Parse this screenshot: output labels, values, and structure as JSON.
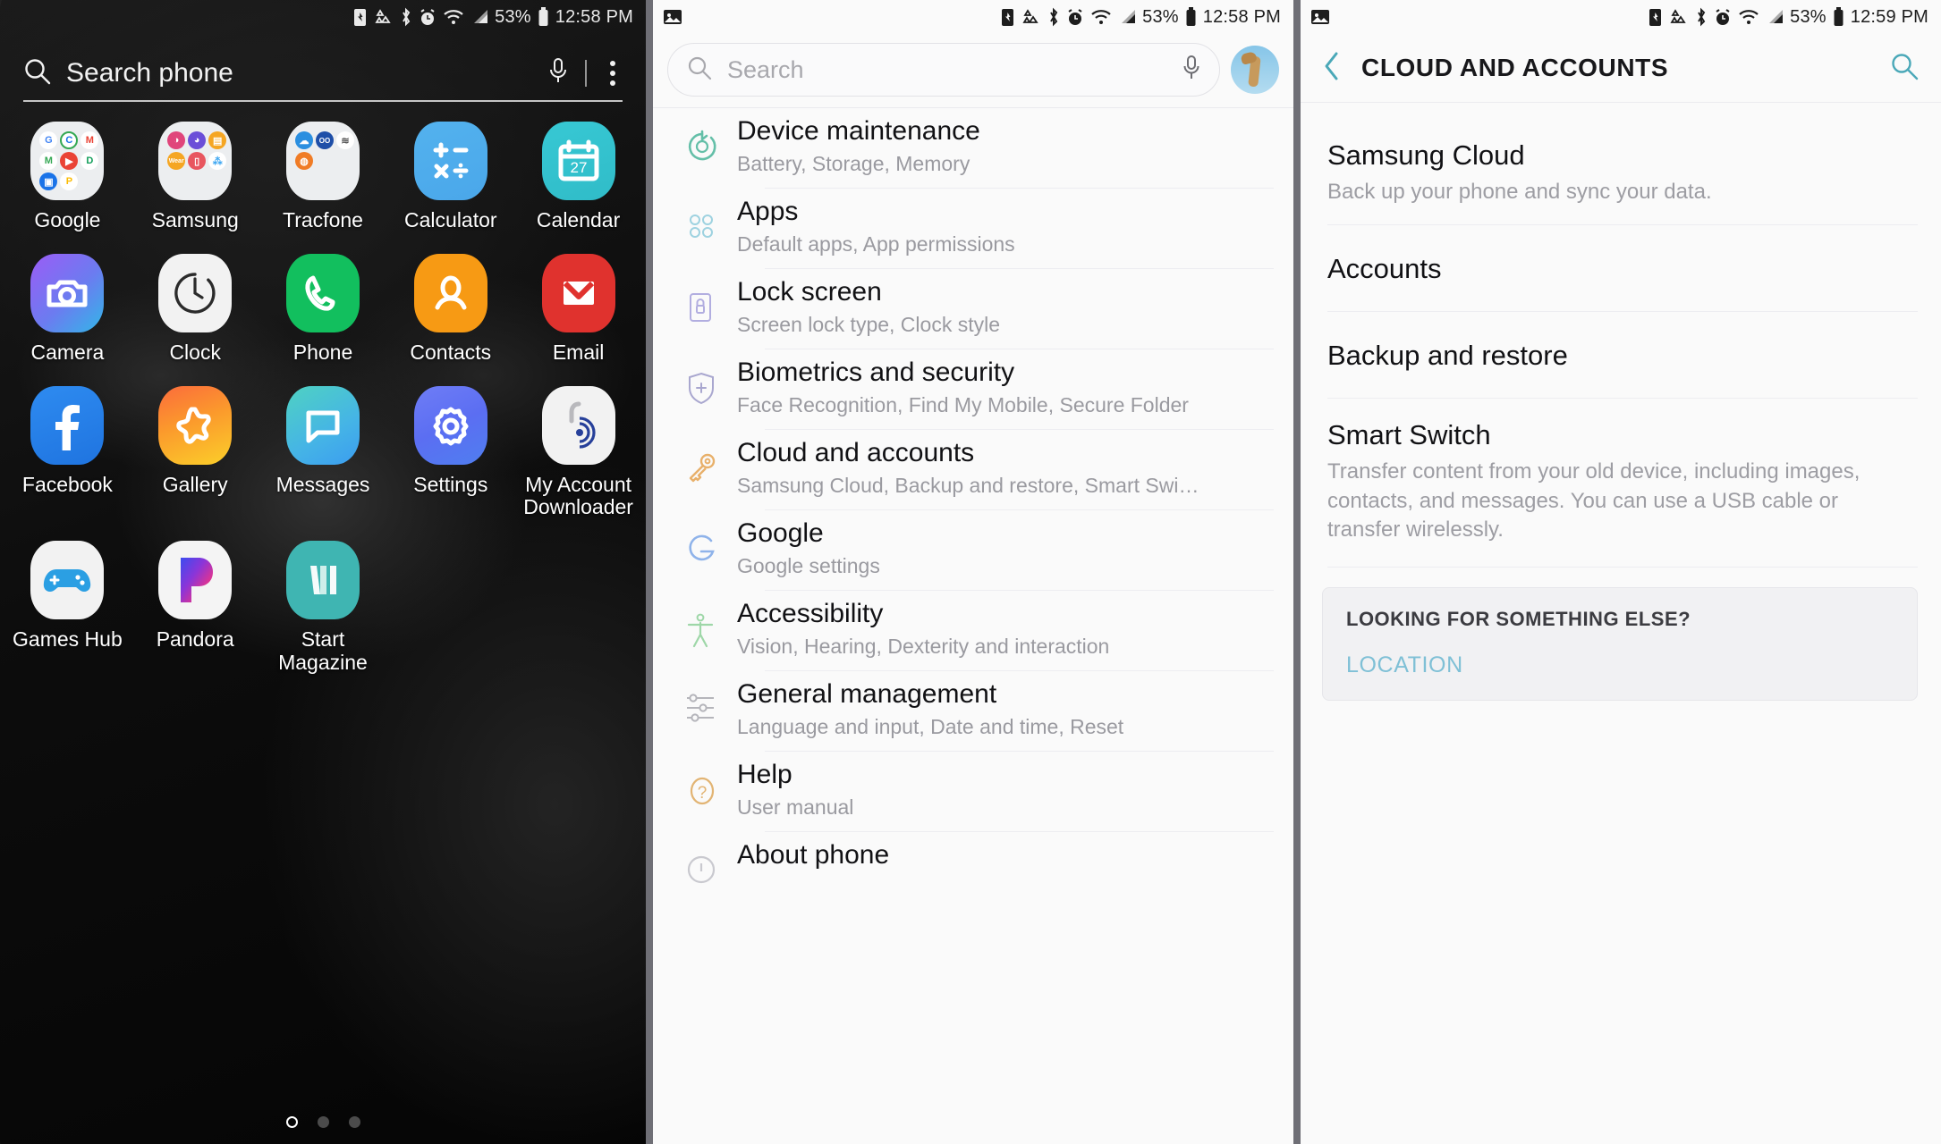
{
  "panels": {
    "home": {
      "statusbar": {
        "icons": [
          "nfc-battery-icon",
          "data-saver-icon",
          "bluetooth-icon",
          "alarm-icon",
          "wifi-icon",
          "signal-icon"
        ],
        "battery_percent": "53%",
        "time": "12:58 PM"
      },
      "search": {
        "placeholder": "Search phone",
        "mic_icon": "microphone-icon",
        "more_icon": "overflow-menu-icon"
      },
      "apps": [
        {
          "label": "Google",
          "type": "folder",
          "minis": [
            "G",
            "C",
            "M",
            "M",
            "Y",
            "D",
            "D",
            "P"
          ]
        },
        {
          "label": "Samsung",
          "type": "folder",
          "minis": [
            "S",
            "I",
            "N",
            "W",
            "H",
            "S"
          ]
        },
        {
          "label": "Tracfone",
          "type": "folder",
          "minis": [
            "C",
            "V",
            "W",
            "B"
          ]
        },
        {
          "label": "Calculator",
          "type": "app",
          "icon": "calculator-icon"
        },
        {
          "label": "Calendar",
          "type": "app",
          "icon": "calendar-icon",
          "day": "27"
        },
        {
          "label": "Camera",
          "type": "app",
          "icon": "camera-icon"
        },
        {
          "label": "Clock",
          "type": "app",
          "icon": "clock-icon"
        },
        {
          "label": "Phone",
          "type": "app",
          "icon": "phone-icon"
        },
        {
          "label": "Contacts",
          "type": "app",
          "icon": "contacts-icon"
        },
        {
          "label": "Email",
          "type": "app",
          "icon": "email-icon"
        },
        {
          "label": "Facebook",
          "type": "app",
          "icon": "facebook-icon"
        },
        {
          "label": "Gallery",
          "type": "app",
          "icon": "gallery-icon"
        },
        {
          "label": "Messages",
          "type": "app",
          "icon": "messages-icon"
        },
        {
          "label": "Settings",
          "type": "app",
          "icon": "gear-icon"
        },
        {
          "label": "My Account Downloader",
          "type": "app",
          "icon": "downloader-icon"
        },
        {
          "label": "Games Hub",
          "type": "app",
          "icon": "gamepad-icon"
        },
        {
          "label": "Pandora",
          "type": "app",
          "icon": "pandora-icon"
        },
        {
          "label": "Start Magazine",
          "type": "app",
          "icon": "start-magazine-icon"
        }
      ],
      "page_indicator": {
        "total": 3,
        "current": 1
      }
    },
    "settings": {
      "statusbar": {
        "left_icon": "image-notification-icon",
        "battery_percent": "53%",
        "time": "12:58 PM"
      },
      "search": {
        "placeholder": "Search",
        "mic_icon": "microphone-icon",
        "avatar": "user-avatar"
      },
      "items": [
        {
          "title": "Device maintenance",
          "subtitle": "Battery, Storage, Memory",
          "icon": "device-maintenance-icon"
        },
        {
          "title": "Apps",
          "subtitle": "Default apps, App permissions",
          "icon": "apps-icon"
        },
        {
          "title": "Lock screen",
          "subtitle": "Screen lock type, Clock style",
          "icon": "lock-icon"
        },
        {
          "title": "Biometrics and security",
          "subtitle": "Face Recognition, Find My Mobile, Secure Folder",
          "icon": "shield-icon"
        },
        {
          "title": "Cloud and accounts",
          "subtitle": "Samsung Cloud, Backup and restore, Smart Swi…",
          "icon": "key-icon"
        },
        {
          "title": "Google",
          "subtitle": "Google settings",
          "icon": "google-icon"
        },
        {
          "title": "Accessibility",
          "subtitle": "Vision, Hearing, Dexterity and interaction",
          "icon": "accessibility-icon"
        },
        {
          "title": "General management",
          "subtitle": "Language and input, Date and time, Reset",
          "icon": "sliders-icon"
        },
        {
          "title": "Help",
          "subtitle": "User manual",
          "icon": "help-icon"
        },
        {
          "title": "About phone",
          "subtitle": "",
          "icon": "info-icon"
        }
      ]
    },
    "cloud": {
      "statusbar": {
        "left_icon": "image-notification-icon",
        "battery_percent": "53%",
        "time": "12:59 PM"
      },
      "appbar": {
        "back_icon": "back-chevron-icon",
        "title": "CLOUD AND ACCOUNTS",
        "search_icon": "search-icon"
      },
      "items": [
        {
          "title": "Samsung Cloud",
          "subtitle": "Back up your phone and sync your data."
        },
        {
          "title": "Accounts",
          "subtitle": ""
        },
        {
          "title": "Backup and restore",
          "subtitle": ""
        },
        {
          "title": "Smart Switch",
          "subtitle": "Transfer content from your old device, including images, contacts, and messages. You can use a USB cable or transfer wirelessly."
        }
      ],
      "looking_for": {
        "title": "LOOKING FOR SOMETHING ELSE?",
        "link": "LOCATION"
      }
    }
  },
  "colors": {
    "accent_teal": "#3fb5b2",
    "link_blue": "#7fc0d6",
    "panel_bg": "#fafafa"
  }
}
